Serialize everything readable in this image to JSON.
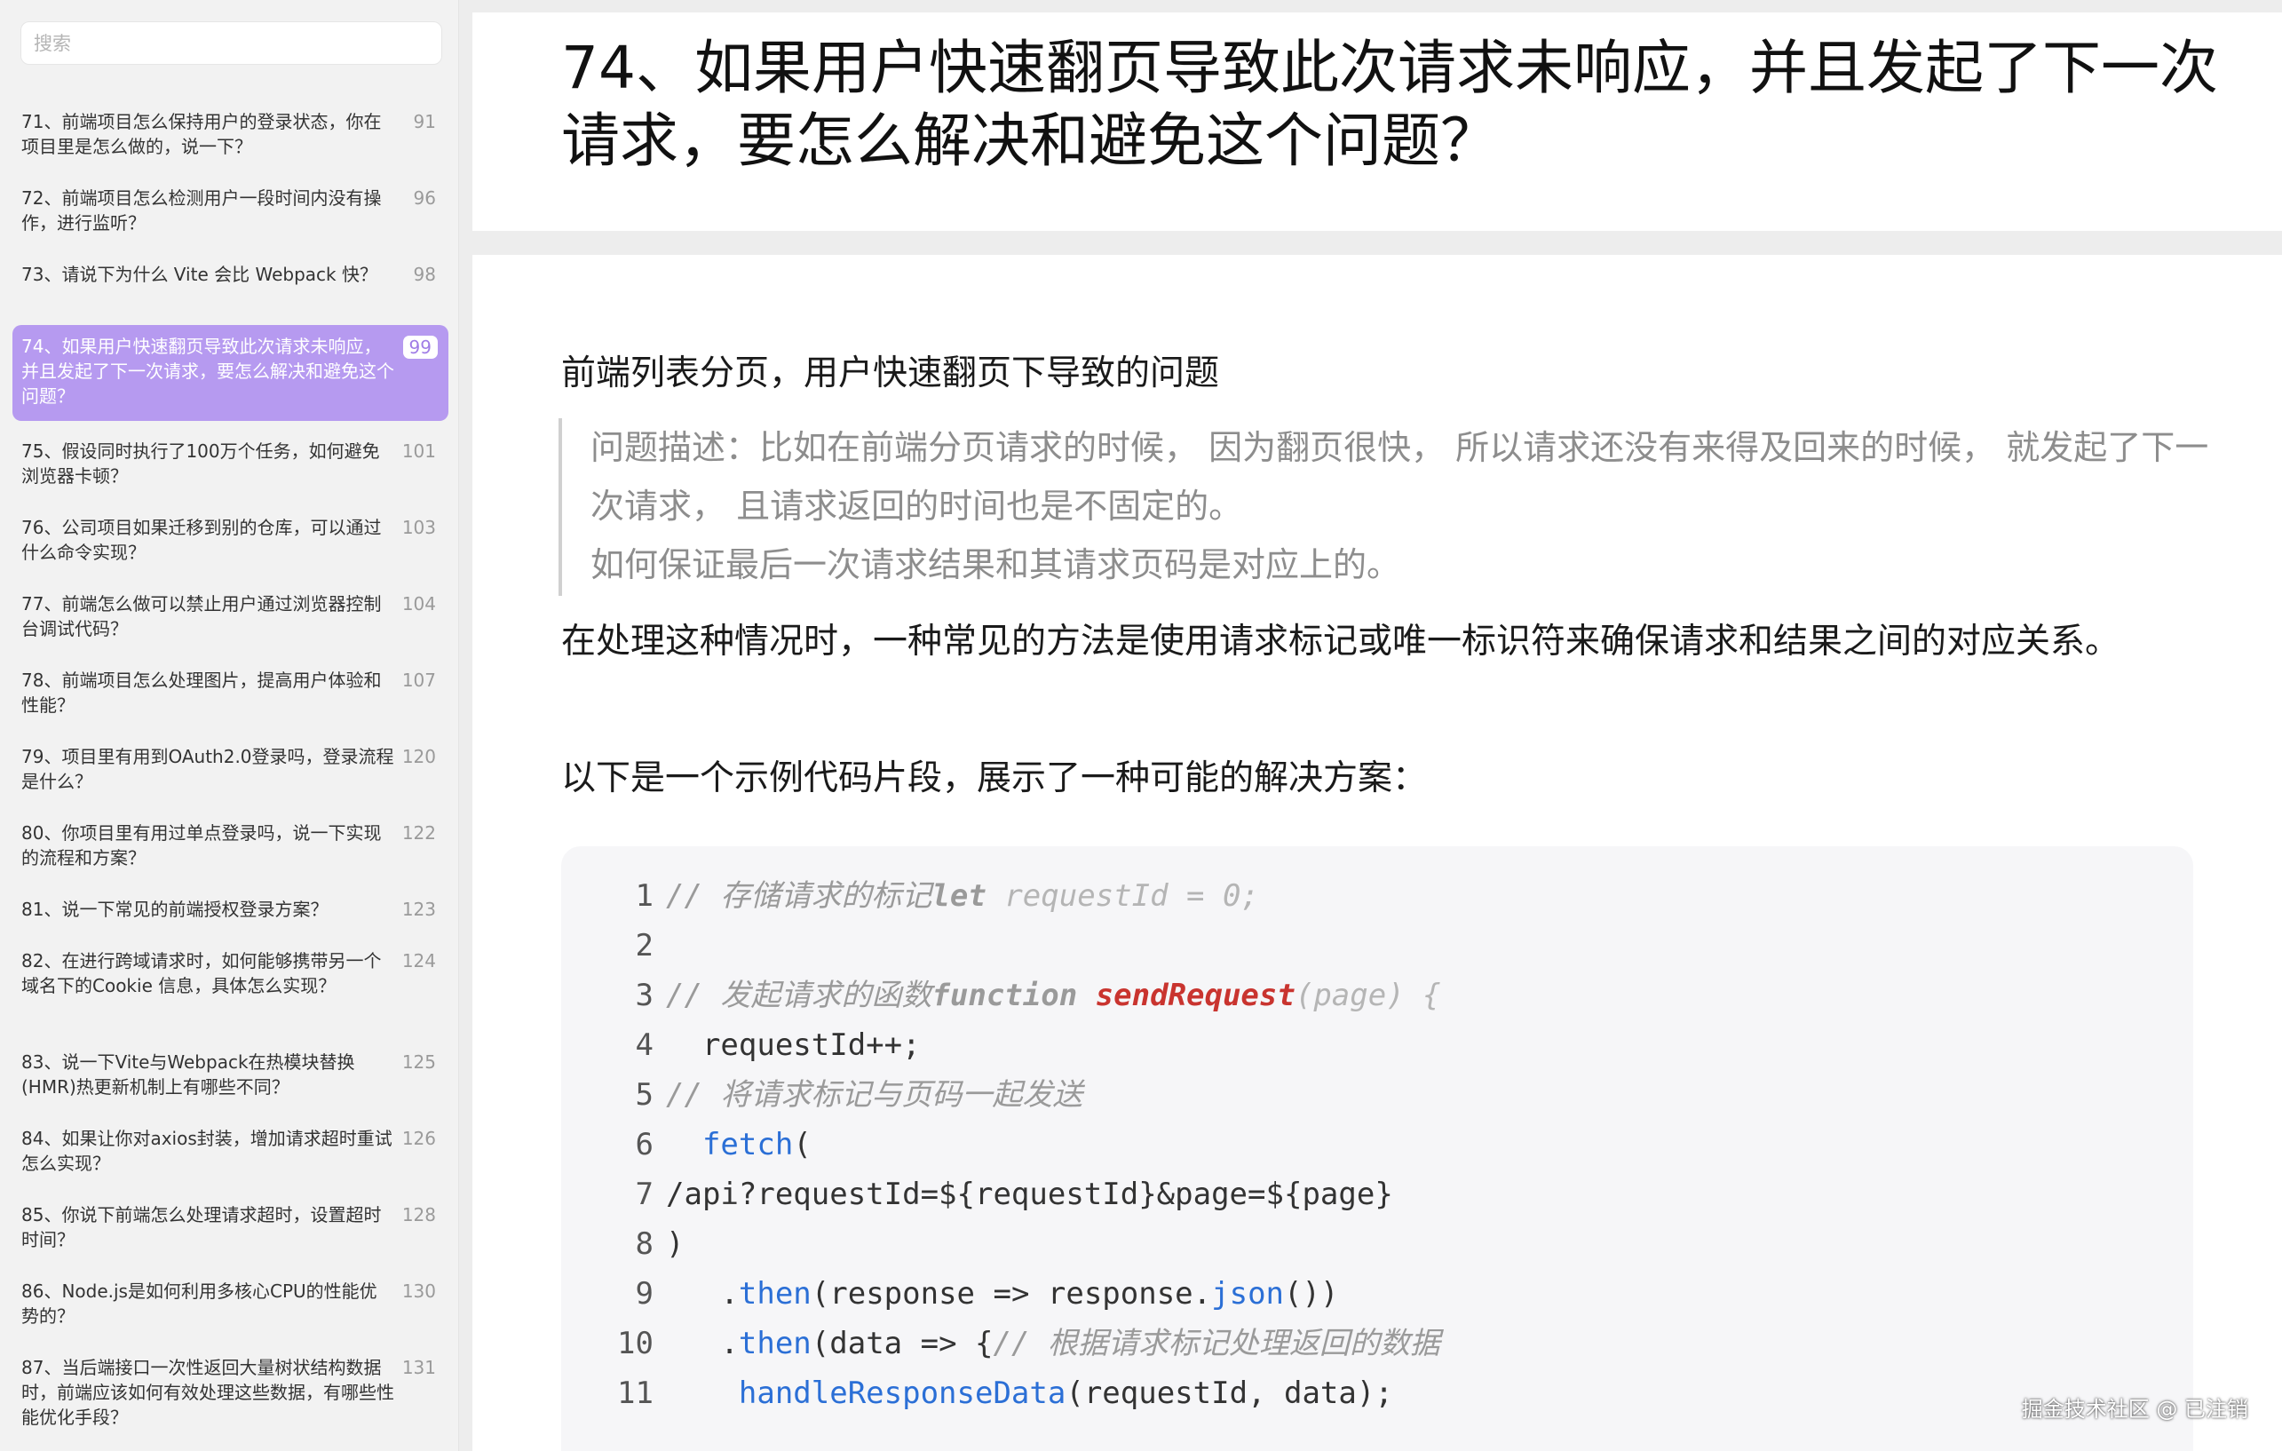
{
  "search": {
    "placeholder": "搜索"
  },
  "toc": [
    {
      "title": "71、前端项目怎么保持用户的登录状态，你在项目里是怎么做的，说一下？",
      "page": "91"
    },
    {
      "title": "72、前端项目怎么检测用户一段时间内没有操作，进行监听？",
      "page": "96"
    },
    {
      "title": "73、请说下为什么 Vite 会比 Webpack 快？",
      "page": "98"
    },
    {
      "title": "74、如果用户快速翻页导致此次请求未响应，并且发起了下一次请求，要怎么解决和避免这个问题？",
      "page": "99",
      "active": true
    },
    {
      "title": "75、假设同时执行了100万个任务，如何避免浏览器卡顿？",
      "page": "101"
    },
    {
      "title": "76、公司项目如果迁移到别的仓库，可以通过什么命令实现？",
      "page": "103"
    },
    {
      "title": "77、前端怎么做可以禁止用户通过浏览器控制台调试代码？",
      "page": "104"
    },
    {
      "title": "78、前端项目怎么处理图片，提高用户体验和性能？",
      "page": "107"
    },
    {
      "title": "79、项目里有用到OAuth2.0登录吗，登录流程是什么？",
      "page": "120"
    },
    {
      "title": "80、你项目里有用过单点登录吗，说一下实现的流程和方案？",
      "page": "122"
    },
    {
      "title": "81、说一下常见的前端授权登录方案？",
      "page": "123"
    },
    {
      "title": "82、在进行跨域请求时，如何能够携带另一个域名下的Cookie 信息，具体怎么实现？",
      "page": "124"
    },
    {
      "title": "83、说一下Vite与Webpack在热模块替换(HMR)热更新机制上有哪些不同？",
      "page": "125"
    },
    {
      "title": "84、如果让你对axios封装，增加请求超时重试怎么实现？",
      "page": "126"
    },
    {
      "title": "85、你说下前端怎么处理请求超时，设置超时时间？",
      "page": "128"
    },
    {
      "title": "86、Node.js是如何利用多核心CPU的性能优势的？",
      "page": "130"
    },
    {
      "title": "87、当后端接口一次性返回大量树状结构数据时，前端应该如何有效处理这些数据，有哪些性能优化手段？",
      "page": "131"
    }
  ],
  "article": {
    "title": "74、如果用户快速翻页导致此次请求未响应，并且发起了下一次请求，要怎么解决和避免这个问题？",
    "heading": "前端列表分页，用户快速翻页下导致的问题",
    "quote_line1": "问题描述：比如在前端分页请求的时候， 因为翻页很快， 所以请求还没有来得及回来的时候， 就发起了下一次请求， 且请求返回的时间也是不固定的。",
    "quote_line2": "如何保证最后一次请求结果和其请求页码是对应上的。",
    "para1": "在处理这种情况时，一种常见的方法是使用请求标记或唯一标识符来确保请求和结果之间的对应关系。",
    "para2": "以下是一个示例代码片段，展示了一种可能的解决方案："
  },
  "code": {
    "l1_num": "1",
    "l1_comment": "// 存储请求的标记",
    "l1_kw": "let",
    "l1_rest": " requestId = 0;",
    "l2_num": "2",
    "l3_num": "3",
    "l3_comment": "// 发起请求的函数",
    "l3_kw": "function",
    "l3_fn": "sendRequest",
    "l3_rest": "(page) {",
    "l4_num": "4",
    "l4_text": "  requestId++;",
    "l5_num": "5",
    "l5_comment": "// 将请求标记与页码一起发送",
    "l6_num": "6",
    "l6_fetch": "fetch",
    "l6_rest": "(",
    "l7_num": "7",
    "l7_text": "/api?requestId=${requestId}&page=${page}",
    "l8_num": "8",
    "l8_text": ")",
    "l9_num": "9",
    "l9_dot": "   .",
    "l9_then": "then",
    "l9_mid": "(response => response.",
    "l9_json": "json",
    "l9_end": "())",
    "l10_num": "10",
    "l10_dot": "   .",
    "l10_then": "then",
    "l10_mid": "(data => {",
    "l10_comment": "// 根据请求标记处理返回的数据",
    "l11_num": "11",
    "l11_fn": "handleResponseData",
    "l11_rest": "(requestId, data);"
  },
  "watermark": "掘金技术社区 @ 已注销",
  "colors": {
    "accent": "#b69af0",
    "code_fn": "#c9342f",
    "code_method": "#2b6fd6"
  }
}
